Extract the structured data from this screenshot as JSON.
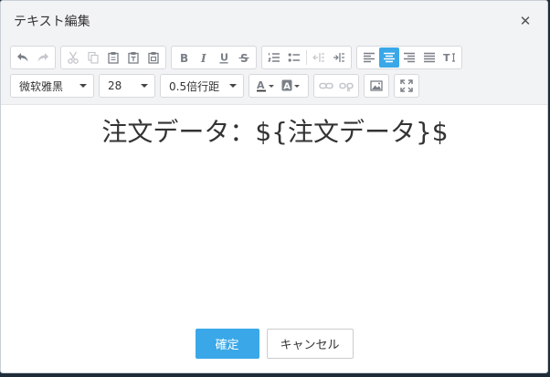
{
  "dialog": {
    "title": "テキスト編集",
    "close_symbol": "✕"
  },
  "toolbar": {
    "font_family": "微软雅黑",
    "font_size": "28",
    "line_spacing": "0.5倍行距"
  },
  "editor": {
    "content": "注文データ：${注文データ}$"
  },
  "footer": {
    "confirm_label": "確定",
    "cancel_label": "キャンセル"
  },
  "colors": {
    "accent": "#3aa8e8",
    "icon": "#7a7f87",
    "icon_disabled": "#c4c7cc"
  }
}
